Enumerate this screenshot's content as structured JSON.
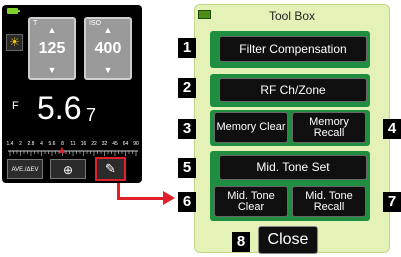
{
  "meter": {
    "shutter_tag": "T",
    "shutter_value": "125",
    "iso_tag": "ISO",
    "iso_value": "400",
    "f_label": "F",
    "f_main": "5.6",
    "f_sub": "7",
    "scale_labels": [
      "1.4",
      "2",
      "2.8",
      "4",
      "5.6",
      "8",
      "11",
      "16",
      "22",
      "32",
      "45",
      "64",
      "90"
    ],
    "ave_button": "AVE./ΔEV",
    "accent_color": "#e0202a",
    "battery_color": "#7fd12b"
  },
  "toolbox": {
    "title": "Tool Box",
    "panel_color": "#e4f2b8",
    "band_color": "#1f8e40",
    "items": [
      {
        "num": "1",
        "label": "Filter Compensation"
      },
      {
        "num": "2",
        "label": "RF Ch/Zone"
      },
      {
        "num": "3",
        "label": "Memory Clear"
      },
      {
        "num": "4",
        "label": "Memory Recall"
      },
      {
        "num": "5",
        "label": "Mid. Tone Set"
      },
      {
        "num": "6",
        "label": "Mid. Tone Clear"
      },
      {
        "num": "7",
        "label": "Mid. Tone Recall"
      },
      {
        "num": "8",
        "label": "Close"
      }
    ]
  }
}
